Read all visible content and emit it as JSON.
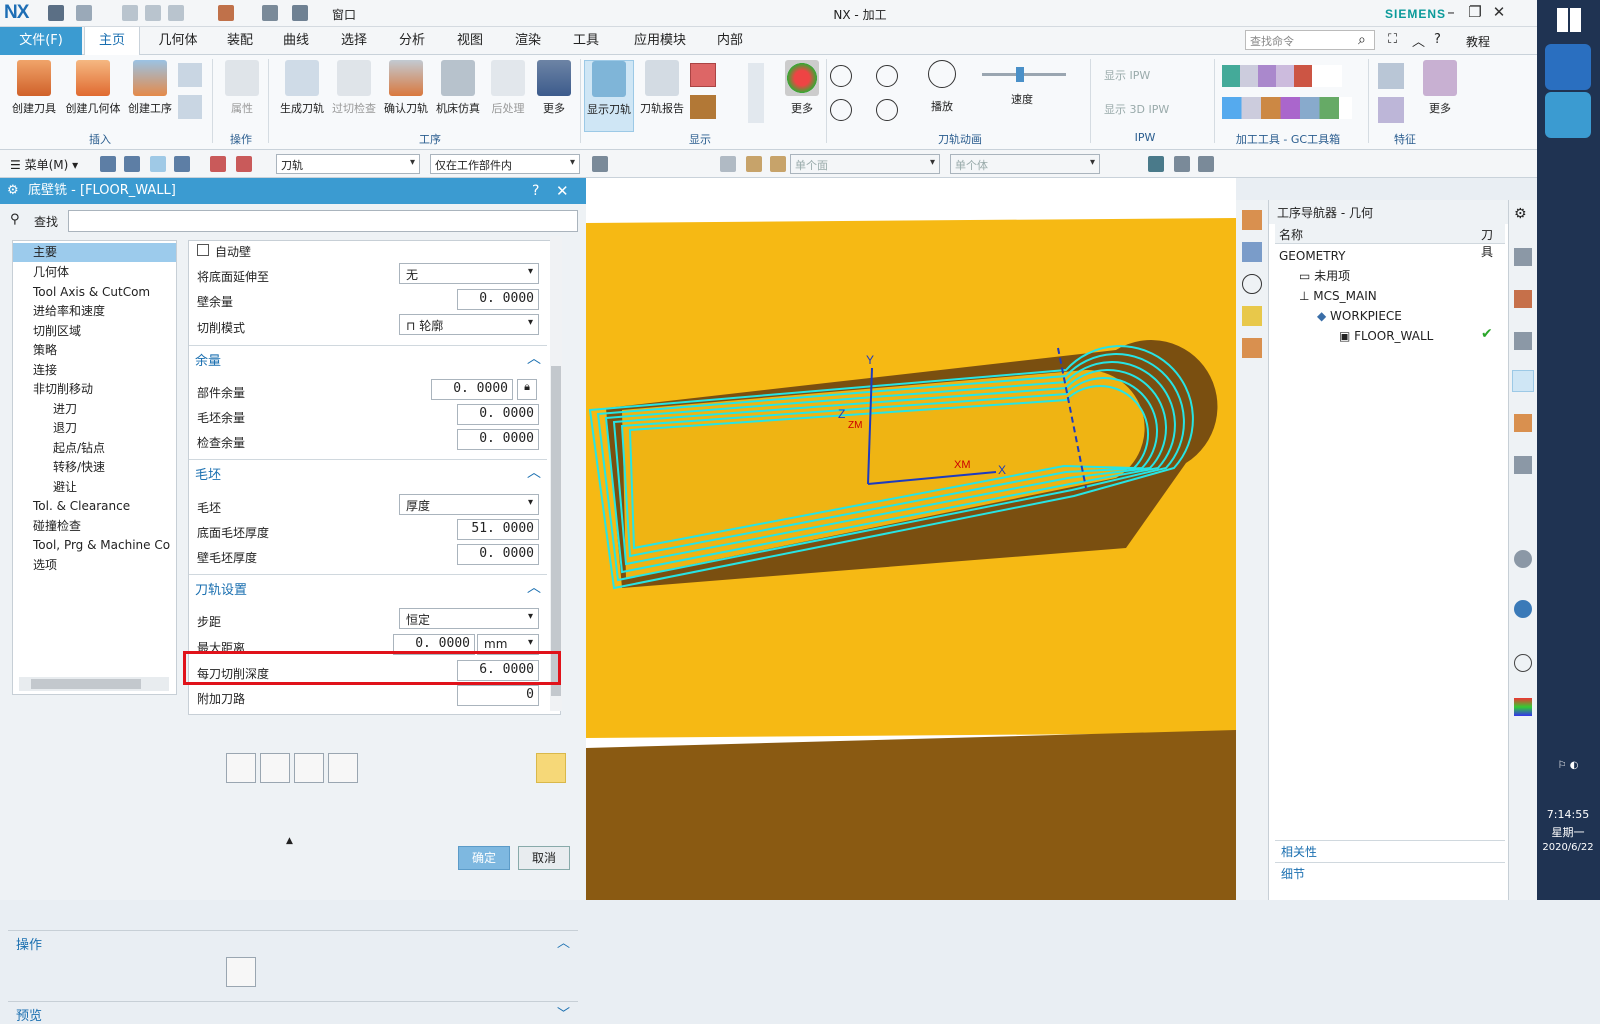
{
  "app": {
    "logo": "NX",
    "title": "NX - 加工",
    "brand": "SIEMENS",
    "window_menu": "窗口"
  },
  "tabs": {
    "file": "文件(F)",
    "items": [
      "主页",
      "几何体",
      "装配",
      "曲线",
      "选择",
      "分析",
      "视图",
      "渲染",
      "工具",
      "应用模块",
      "内部"
    ],
    "command_search": "查找命令",
    "tutorial": "教程"
  },
  "ribbon": {
    "buttons": [
      "创建刀具",
      "创建几何体",
      "创建工序",
      "属性",
      "生成刀轨",
      "过切检查",
      "确认刀轨",
      "机床仿真",
      "后处理",
      "更多",
      "显示刀轨",
      "刀轨报告",
      "更多",
      "播放",
      "速度",
      "显示 IPW",
      "显示 3D IPW",
      "更多"
    ],
    "groups": [
      "插入",
      "操作",
      "工序",
      "显示",
      "刀轨动画",
      "IPW",
      "加工工具 - GC工具箱",
      "特征"
    ]
  },
  "toolbar2": {
    "menu": "菜单(M)",
    "filter1": "刀轨",
    "filter2": "仅在工作部件内",
    "filter3": "单个面",
    "filter4": "单个体"
  },
  "dialog": {
    "title": "底壁铣 - [FLOOR_WALL]",
    "find_label": "查找",
    "tree": [
      "主要",
      "几何体",
      "Tool Axis & CutCom",
      "进给率和速度",
      "切削区域",
      "策略",
      "连接",
      "非切削移动",
      "进刀",
      "退刀",
      "起点/钻点",
      "转移/快速",
      "避让",
      "Tol. & Clearance",
      "碰撞检查",
      "Tool, Prg & Machine Co",
      "选项"
    ],
    "auto_wall": "自动壁",
    "extend_floor": {
      "label": "将底面延伸至",
      "value": "无"
    },
    "wall_stock": {
      "label": "壁余量",
      "value": "0. 0000"
    },
    "cut_pattern": {
      "label": "切削模式",
      "value": "轮廓"
    },
    "stock_section": "余量",
    "part_stock": {
      "label": "部件余量",
      "value": "0. 0000"
    },
    "blank_stock": {
      "label": "毛坯余量",
      "value": "0. 0000"
    },
    "check_stock": {
      "label": "检查余量",
      "value": "0. 0000"
    },
    "blank_section": "毛坯",
    "blank": {
      "label": "毛坯",
      "value": "厚度"
    },
    "floor_blank": {
      "label": "底面毛坯厚度",
      "value": "51. 0000"
    },
    "wall_blank": {
      "label": "壁毛坯厚度",
      "value": "0. 0000"
    },
    "path_section": "刀轨设置",
    "stepover": {
      "label": "步距",
      "value": "恒定"
    },
    "max_dist": {
      "label": "最大距离",
      "value": "0. 0000",
      "unit": "mm"
    },
    "depth_per_cut": {
      "label": "每刀切削深度",
      "value": "6. 0000"
    },
    "extra_passes": {
      "label": "附加刀路",
      "value": "0"
    },
    "ops_section": "操作",
    "preview_section": "预览",
    "ok": "确定",
    "cancel": "取消"
  },
  "viewport": {
    "axis_x": "X",
    "axis_y": "Y",
    "axis_z": "Z",
    "axis_xm": "XM",
    "axis_zm": "ZM"
  },
  "navigator": {
    "title": "工序导航器 - 几何",
    "col_name": "名称",
    "col_tool": "刀具",
    "rows": [
      "GEOMETRY",
      "未用项",
      "MCS_MAIN",
      "WORKPIECE",
      "FLOOR_WALL"
    ],
    "relevance": "相关性",
    "details": "细节"
  },
  "taskbar": {
    "time": "7:14:55",
    "weekday": "星期一",
    "date": "2020/6/22"
  },
  "colors": {
    "accent": "#3b9bd1",
    "part_face": "#f6b914",
    "part_wall": "#8a5a12",
    "toolpath": "#27e4e4",
    "highlight": "#e0121a"
  }
}
